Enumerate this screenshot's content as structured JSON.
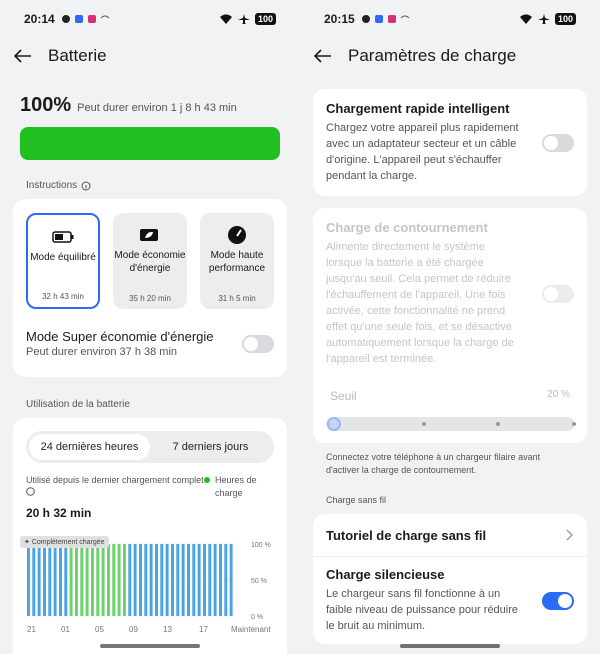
{
  "left": {
    "status": {
      "time": "20:14",
      "battery": "100"
    },
    "title": "Batterie",
    "battery": {
      "percent": "100%",
      "estimate": "Peut durer environ 1 j 8 h 43 min",
      "level": 1.0,
      "color": "#1fc01f"
    },
    "instructions_label": "Instructions",
    "modes": [
      {
        "label": "Mode équilibré",
        "time": "32 h 43 min",
        "icon": "battery-icon",
        "selected": true
      },
      {
        "label": "Mode économie d'énergie",
        "time": "35 h 20 min",
        "icon": "leaf-battery-icon",
        "selected": false
      },
      {
        "label": "Mode haute performance",
        "time": "31 h 5 min",
        "icon": "speedometer-icon",
        "selected": false
      }
    ],
    "super_saver": {
      "title": "Mode Super économie d'énergie",
      "subtitle": "Peut durer environ 37 h 38 min",
      "on": false
    },
    "usage_label": "Utilisation de la batterie",
    "tabs": [
      "24 dernières heures",
      "7 derniers jours"
    ],
    "usage": {
      "since_label": "Utilisé depuis le dernier chargement complet",
      "legend": "Heures de charge",
      "value": "20 h 32 min",
      "chip": "Complètement chargée"
    },
    "chart_data": {
      "type": "bar",
      "x_ticks": [
        "21",
        "01",
        "05",
        "09",
        "13",
        "17",
        "Maintenant"
      ],
      "y_ticks": [
        "100 %",
        "50 %",
        "0 %"
      ],
      "ylim": [
        0,
        100
      ],
      "bar_count": 39,
      "values": [
        100,
        100,
        100,
        100,
        100,
        100,
        100,
        100,
        100,
        100,
        100,
        100,
        100,
        100,
        100,
        100,
        100,
        100,
        100,
        100,
        100,
        100,
        100,
        100,
        100,
        100,
        100,
        100,
        100,
        100,
        100,
        100,
        100,
        100,
        100,
        100,
        100,
        100,
        100
      ],
      "charging": [
        false,
        false,
        false,
        false,
        false,
        false,
        false,
        false,
        true,
        true,
        true,
        true,
        true,
        true,
        true,
        true,
        true,
        true,
        true,
        false,
        false,
        false,
        false,
        false,
        false,
        false,
        false,
        false,
        false,
        false,
        false,
        false,
        false,
        false,
        false,
        false,
        false,
        false,
        false
      ],
      "colors": {
        "normal": "#4aa3e8",
        "charging": "#6cd06c"
      }
    }
  },
  "right": {
    "status": {
      "time": "20:15",
      "battery": "100"
    },
    "title": "Paramètres de charge",
    "fast_charge": {
      "title": "Chargement rapide intelligent",
      "body": "Chargez votre appareil plus rapidement avec un adaptateur secteur et un câble d'origine. L'appareil peut s'échauffer pendant la charge.",
      "on": false
    },
    "bypass": {
      "title": "Charge de contournement",
      "body": "Alimente directement le système lorsque la batterie a été chargée jusqu'au seuil. Cela permet de réduire l'échauffement de l'appareil. Une fois activée, cette fonctionnalité ne prend effet qu'une seule fois, et se désactive automatiquement lorsque la charge de l'appareil est terminée.",
      "on": false,
      "threshold_label": "Seuil",
      "threshold_value": "20 %"
    },
    "bypass_note": "Connectez votre téléphone à un chargeur filaire avant d'activer la charge de contournement.",
    "wireless_label": "Charge sans fil",
    "wireless_tutorial": "Tutoriel de charge sans fil",
    "silent": {
      "title": "Charge silencieuse",
      "body": "Le chargeur sans fil fonctionne à un faible niveau de puissance pour réduire le bruit au minimum.",
      "on": true
    }
  }
}
